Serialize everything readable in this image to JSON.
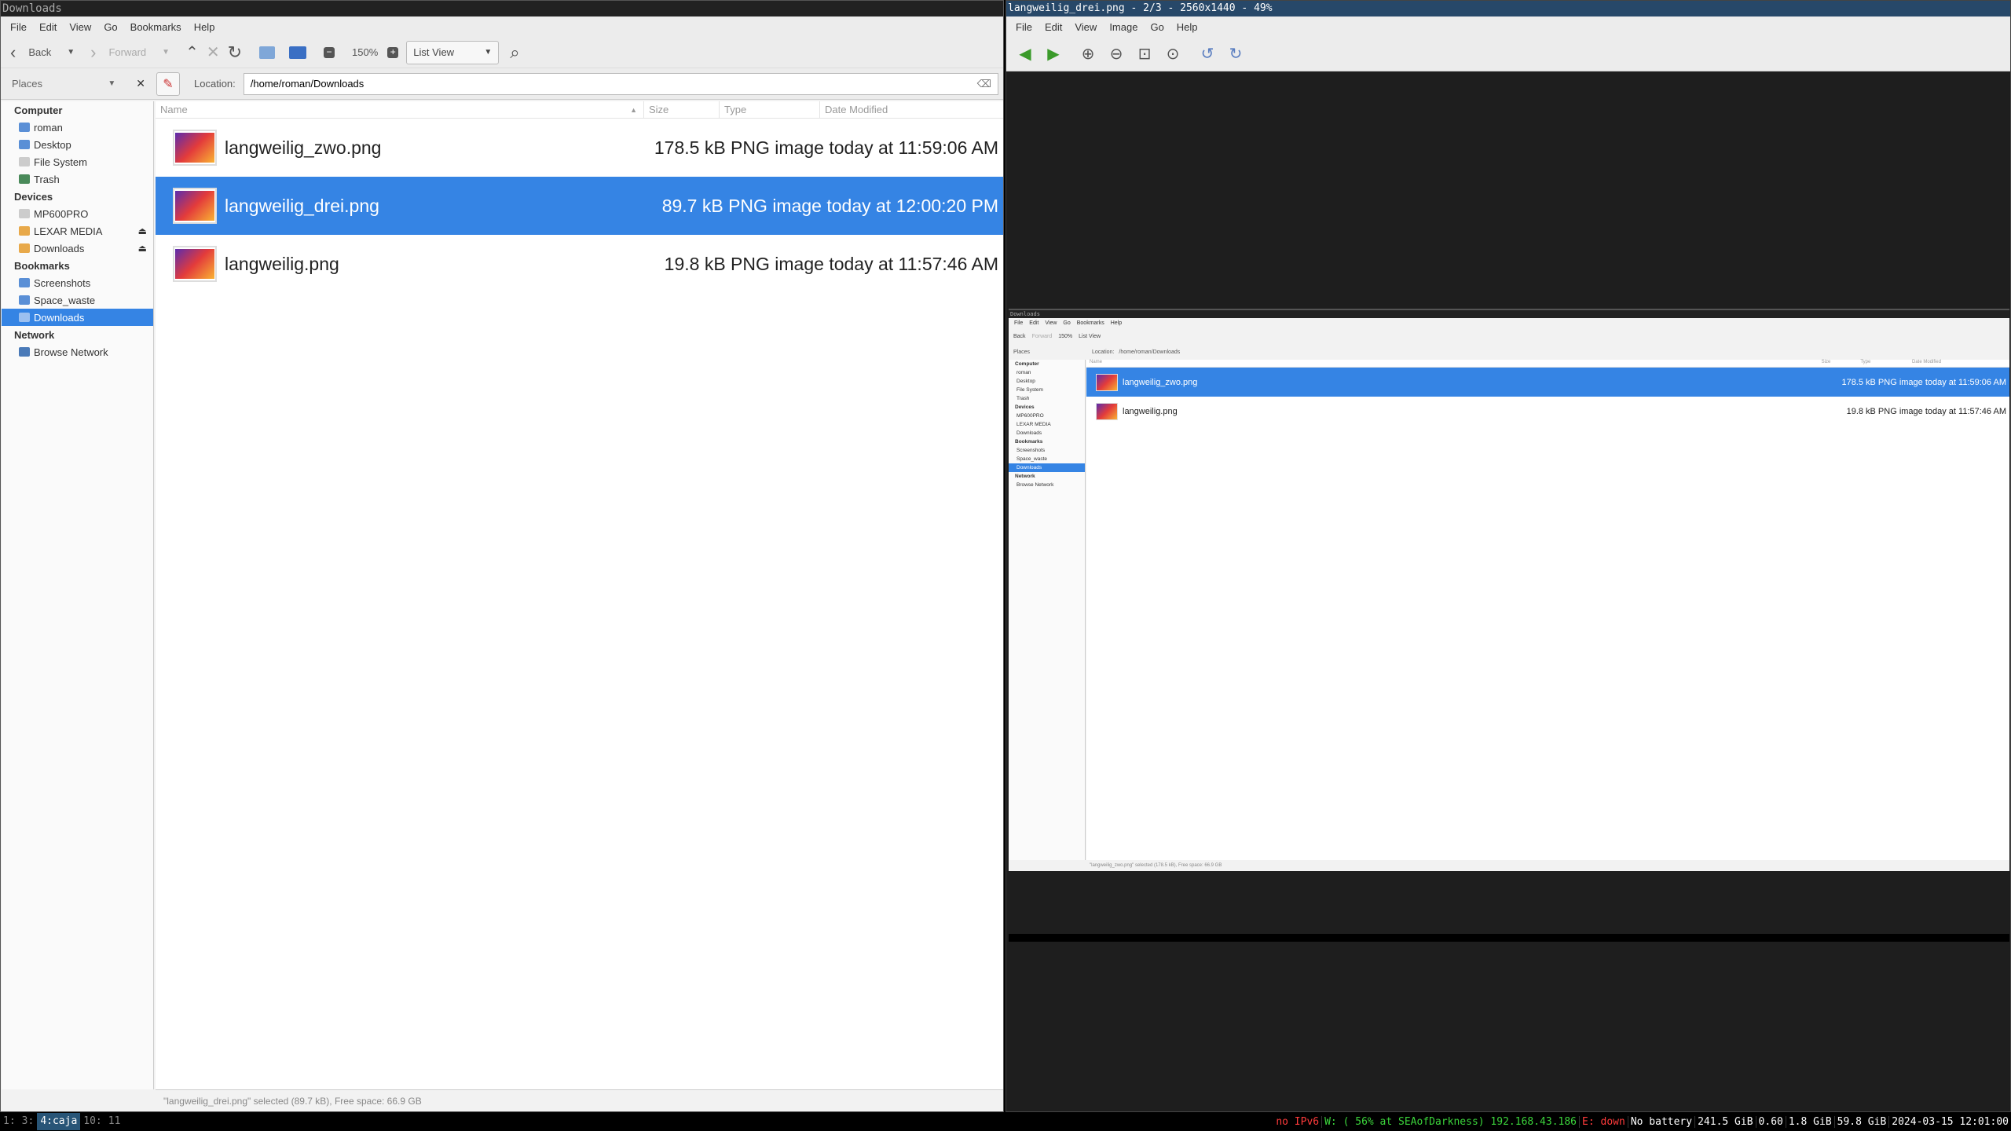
{
  "left": {
    "title": "Downloads",
    "menu": [
      "File",
      "Edit",
      "View",
      "Go",
      "Bookmarks",
      "Help"
    ],
    "toolbar": {
      "back": "Back",
      "forward": "Forward",
      "zoom": "150%",
      "view": "List View"
    },
    "places_label": "Places",
    "location_label": "Location:",
    "location_value": "/home/roman/Downloads",
    "sidebar": {
      "computer": "Computer",
      "computer_items": [
        "roman",
        "Desktop",
        "File System",
        "Trash"
      ],
      "devices": "Devices",
      "device_items": [
        "MP600PRO",
        "LEXAR MEDIA",
        "Downloads"
      ],
      "bookmarks": "Bookmarks",
      "bookmark_items": [
        "Screenshots",
        "Space_waste",
        "Downloads"
      ],
      "network": "Network",
      "network_items": [
        "Browse Network"
      ]
    },
    "columns": [
      "Name",
      "Size",
      "Type",
      "Date Modified"
    ],
    "files": [
      {
        "name": "langweilig_zwo.png",
        "info": "178.5 kB PNG image today at 11:59:06 AM"
      },
      {
        "name": "langweilig_drei.png",
        "info": "89.7 kB PNG image today at 12:00:20 PM"
      },
      {
        "name": "langweilig.png",
        "info": "19.8 kB PNG image today at 11:57:46 AM"
      }
    ],
    "status": "\"langweilig_drei.png\" selected (89.7 kB), Free space: 66.9 GB"
  },
  "right": {
    "title": "langweilig_drei.png - 2/3 - 2560x1440 - 49%",
    "menu": [
      "File",
      "Edit",
      "View",
      "Image",
      "Go",
      "Help"
    ],
    "nested": {
      "title": "Downloads",
      "menu": [
        "File",
        "Edit",
        "View",
        "Go",
        "Bookmarks",
        "Help"
      ],
      "back": "Back",
      "forward": "Forward",
      "zoom": "150%",
      "view": "List View",
      "places": "Places",
      "location": "Location:",
      "location_value": "/home/roman/Downloads",
      "columns": [
        "Name",
        "Size",
        "Type",
        "Date Modified"
      ],
      "files": [
        {
          "name": "langweilig_zwo.png",
          "info": "178.5 kB PNG image today at 11:59:06 AM"
        },
        {
          "name": "langweilig.png",
          "info": "19.8 kB PNG image today at 11:57:46 AM"
        }
      ],
      "sidebar": [
        "Computer",
        "roman",
        "Desktop",
        "File System",
        "Trash",
        "Devices",
        "MP600PRO",
        "LEXAR MEDIA",
        "Downloads",
        "Bookmarks",
        "Screenshots",
        "Space_waste",
        "Downloads",
        "Network",
        "Browse Network"
      ],
      "status": "\"langweilig_zwo.png\" selected (178.5 kB), Free space: 66.9 GB"
    }
  },
  "bar": {
    "workspaces": [
      "1:",
      "3:",
      "4:caja",
      "10:",
      "11"
    ],
    "status": [
      {
        "text": "no IPv6",
        "color": "#ff3b3b"
      },
      {
        "text": "W: ( 56% at SEAofDarkness) 192.168.43.186",
        "color": "#3bd43b"
      },
      {
        "text": "E: down",
        "color": "#ff3b3b"
      },
      {
        "text": "No battery",
        "color": "#ffffff"
      },
      {
        "text": "241.5 GiB",
        "color": "#ffffff"
      },
      {
        "text": "0.60",
        "color": "#ffffff"
      },
      {
        "text": "1.8 GiB",
        "color": "#ffffff"
      },
      {
        "text": "59.8 GiB",
        "color": "#ffffff"
      },
      {
        "text": "2024-03-15 12:01:00",
        "color": "#ffffff"
      }
    ]
  }
}
